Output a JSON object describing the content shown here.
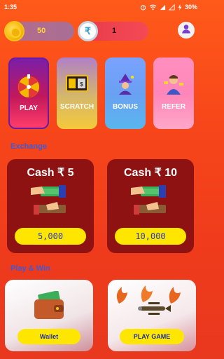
{
  "status_bar": {
    "time": "1:35",
    "battery": "30%"
  },
  "header": {
    "coins": "50",
    "cash": "1",
    "rupee_symbol": "₹"
  },
  "tiles": [
    {
      "label": "PLAY"
    },
    {
      "label": "SCRATCH"
    },
    {
      "label": "BONUS"
    },
    {
      "label": "REFER"
    }
  ],
  "exchange": {
    "title": "Exchange",
    "cards": [
      {
        "title": "Cash ₹ 5",
        "price": "5,000"
      },
      {
        "title": "Cash ₹ 10",
        "price": "10,000"
      }
    ]
  },
  "play_win": {
    "title": "Play & Win",
    "cards": [
      {
        "button": "Wallet"
      },
      {
        "button": "PLAY GAME"
      }
    ]
  },
  "colors": {
    "background": "#f7461a",
    "card": "#8f1212",
    "accent_yellow": "#ffe600",
    "section_title": "#3d5ad8"
  }
}
